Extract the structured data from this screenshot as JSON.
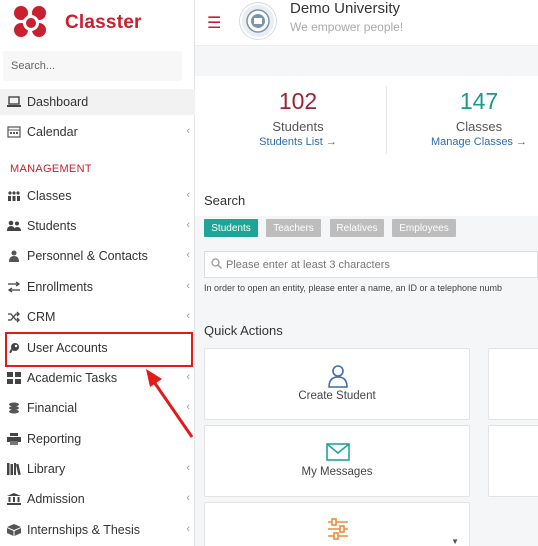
{
  "brand": {
    "name": "Classter",
    "color": "#c8202f"
  },
  "sidebar": {
    "search_placeholder": "Search...",
    "section_label": "MANAGEMENT",
    "items": [
      {
        "label": "Dashboard",
        "icon": "laptop-icon",
        "has_chevron": false
      },
      {
        "label": "Calendar",
        "icon": "calendar-icon",
        "has_chevron": true
      },
      {
        "label": "Classes",
        "icon": "classes-grid-icon",
        "has_chevron": true
      },
      {
        "label": "Students",
        "icon": "students-icon",
        "has_chevron": true
      },
      {
        "label": "Personnel & Contacts",
        "icon": "person-icon",
        "has_chevron": true
      },
      {
        "label": "Enrollments",
        "icon": "arrows-icon",
        "has_chevron": true
      },
      {
        "label": "CRM",
        "icon": "shuffle-icon",
        "has_chevron": true
      },
      {
        "label": "User Accounts",
        "icon": "key-icon",
        "has_chevron": false
      },
      {
        "label": "Academic Tasks",
        "icon": "grid-icon",
        "has_chevron": true
      },
      {
        "label": "Financial",
        "icon": "coins-icon",
        "has_chevron": true
      },
      {
        "label": "Reporting",
        "icon": "printer-icon",
        "has_chevron": false
      },
      {
        "label": "Library",
        "icon": "books-icon",
        "has_chevron": true
      },
      {
        "label": "Admission",
        "icon": "institution-icon",
        "has_chevron": true
      },
      {
        "label": "Internships & Thesis",
        "icon": "box-icon",
        "has_chevron": true
      }
    ]
  },
  "header": {
    "menu_icon": "hamburger-icon",
    "university_name": "Demo University",
    "tagline": "We empower people!"
  },
  "stats": [
    {
      "value": "102",
      "label": "Students",
      "link": "Students List →",
      "color": "#9b2335"
    },
    {
      "value": "147",
      "label": "Classes",
      "link": "Manage Classes →",
      "color": "#1a9a8a"
    }
  ],
  "search": {
    "title": "Search",
    "tabs": [
      {
        "label": "Students",
        "active": true
      },
      {
        "label": "Teachers",
        "active": false
      },
      {
        "label": "Relatives",
        "active": false
      },
      {
        "label": "Employees",
        "active": false
      }
    ],
    "placeholder": "Please enter at least 3 characters",
    "hint": "In order to open an entity, please enter a name, an ID or a telephone numb"
  },
  "quick_actions": {
    "title": "Quick Actions",
    "items": [
      {
        "label": "Create Student",
        "icon": "user-outline-icon"
      },
      {
        "label": "My Messages",
        "icon": "envelope-icon"
      },
      {
        "label": "",
        "icon": "sliders-icon"
      }
    ]
  },
  "colors": {
    "accent": "#c8202f",
    "teal": "#1a9a8a",
    "link": "#2b6cb0",
    "annotation": "#e21a1a"
  }
}
